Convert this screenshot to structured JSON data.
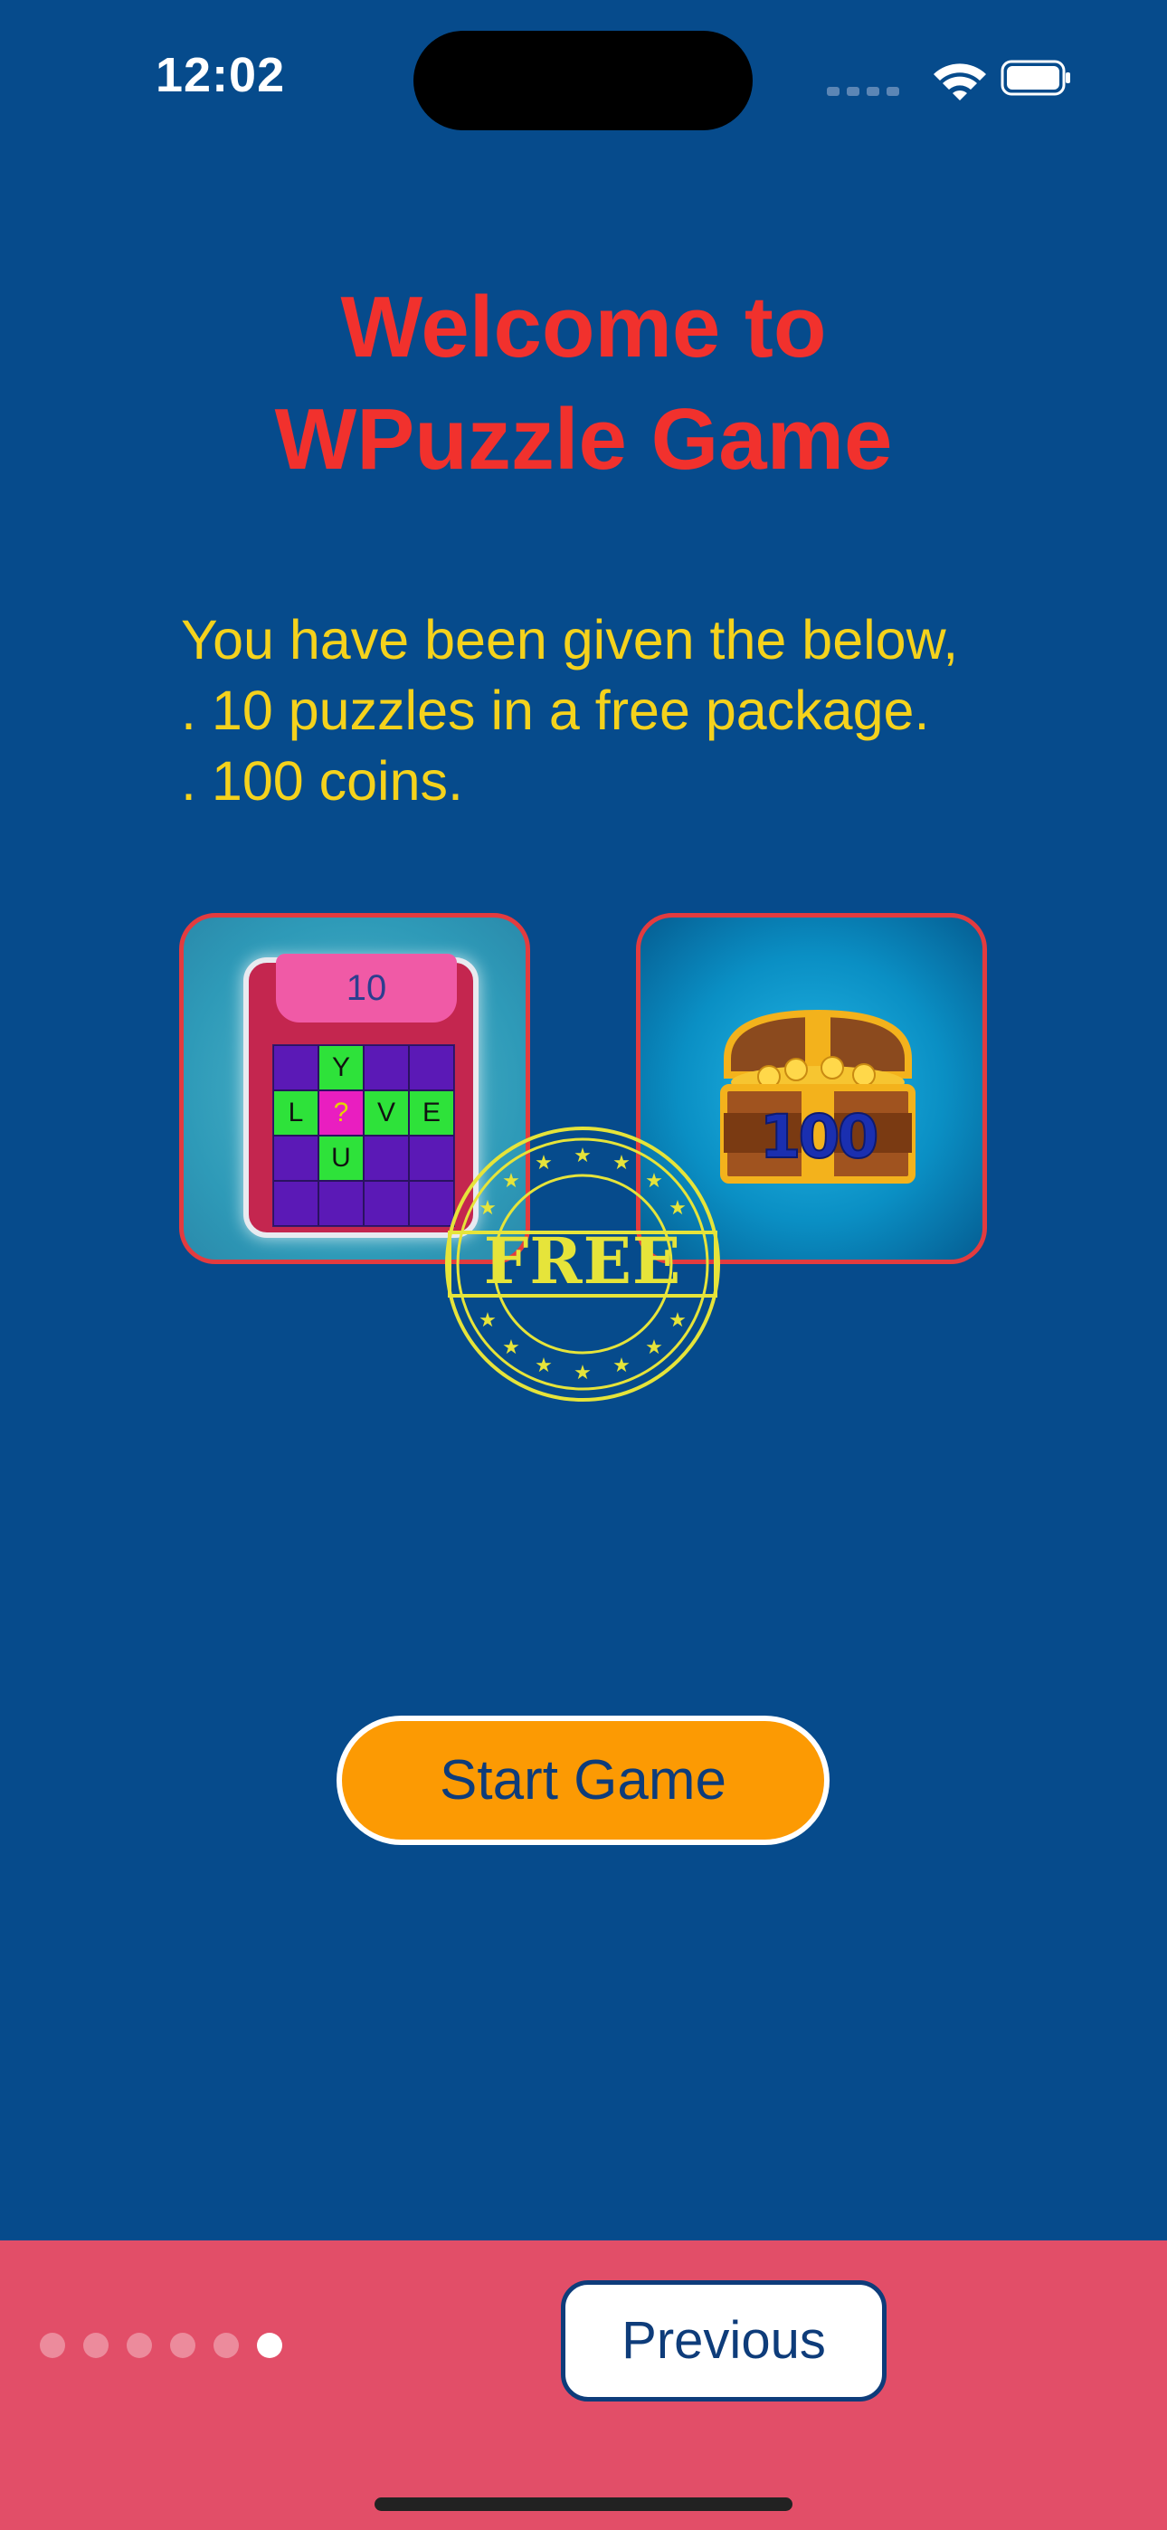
{
  "status_bar": {
    "time": "12:02"
  },
  "title": {
    "line1": "Welcome to",
    "line2": "WPuzzle Game"
  },
  "message": {
    "line1": "You have been given the below,",
    "line2": ". 10 puzzles in a free package.",
    "line3": ". 100 coins."
  },
  "puzzle_card": {
    "count": "10",
    "cells": [
      "",
      "Y",
      "",
      "",
      "L",
      "?",
      "V",
      "E",
      "",
      "U",
      "",
      "",
      "",
      "",
      "",
      ""
    ]
  },
  "coins_card": {
    "amount": "100"
  },
  "stamp": {
    "text": "FREE"
  },
  "start_button": {
    "label": "Start Game"
  },
  "bottom_bar": {
    "previous_label": "Previous",
    "page_count": 6,
    "active_page": 6
  },
  "colors": {
    "background": "#064B8C",
    "title": "#F1312D",
    "message": "#F5D21C",
    "button": "#FC9A03",
    "bottom_bar": "#E24E68"
  }
}
